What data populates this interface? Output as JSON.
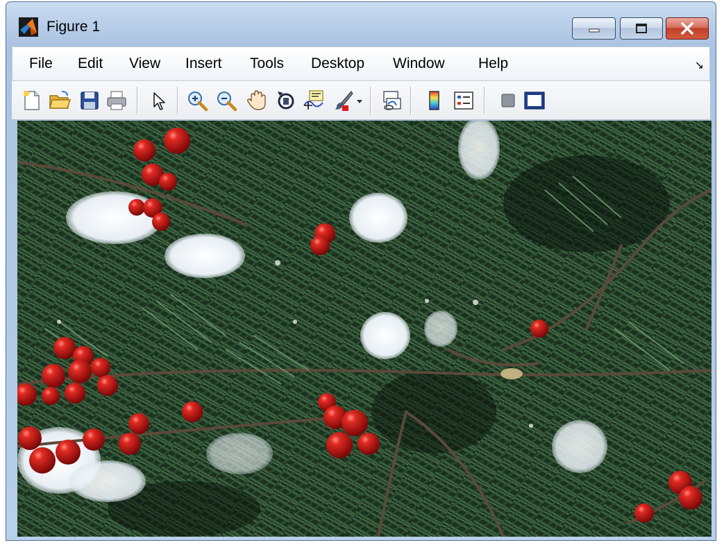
{
  "window": {
    "title": "Figure 1"
  },
  "menu": {
    "items": [
      "File",
      "Edit",
      "View",
      "Insert",
      "Tools",
      "Desktop",
      "Window",
      "Help"
    ]
  },
  "toolbar": {
    "buttons": [
      "new-figure-icon",
      "open-file-icon",
      "save-icon",
      "print-icon",
      "edit-plot-arrow-icon",
      "zoom-in-icon",
      "zoom-out-icon",
      "pan-hand-icon",
      "rotate-3d-icon",
      "data-cursor-icon",
      "brush-icon",
      "brush-dropdown-icon",
      "link-plot-icon",
      "colorbar-icon",
      "legend-icon",
      "hide-plot-tools-icon",
      "show-plot-tools-icon"
    ]
  },
  "figure": {
    "content": "photo-holly-berries-evergreen-snow",
    "colors": {
      "berry": "#c01818",
      "needles": "#2f4d2b",
      "snow": "#eef3f7",
      "background": "#0e1a10"
    }
  }
}
